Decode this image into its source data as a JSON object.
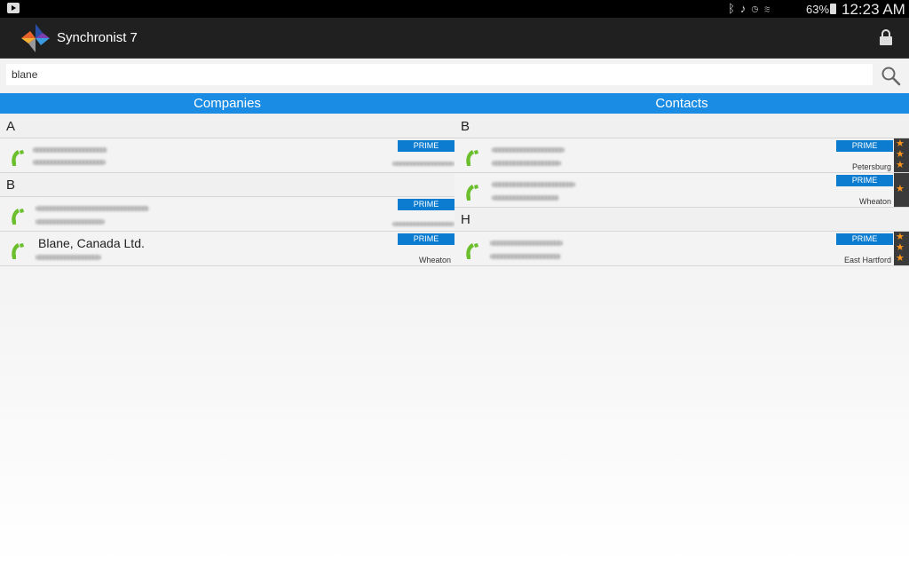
{
  "status_bar": {
    "battery_percent": "63%",
    "time": "12:23 AM"
  },
  "app": {
    "title": "Synchronist 7"
  },
  "search": {
    "value": "blane"
  },
  "columns": {
    "companies_label": "Companies",
    "contacts_label": "Contacts"
  },
  "companies": {
    "section_a": "A",
    "section_b": "B",
    "row1": {
      "badge": "PRIME"
    },
    "row2": {
      "badge": "PRIME"
    },
    "row3": {
      "name": "Blane, Canada Ltd.",
      "badge": "PRIME",
      "city": "Wheaton"
    }
  },
  "contacts": {
    "section_b": "B",
    "section_h": "H",
    "row1": {
      "badge": "PRIME",
      "city": "Petersburg",
      "stars": 3
    },
    "row2": {
      "badge": "PRIME",
      "city": "Wheaton",
      "stars": 1
    },
    "row3": {
      "badge": "PRIME",
      "city": "East Hartford",
      "stars": 3
    }
  },
  "colors": {
    "accent": "#1b8ce3",
    "badge": "#0b7cd0",
    "phone": "#6cbf2c",
    "star": "#f7941d"
  },
  "icons": [
    "notification-icon",
    "bluetooth-icon",
    "mute-icon",
    "alarm-icon",
    "wifi-icon",
    "battery-icon",
    "app-logo-icon",
    "lock-icon",
    "search-icon",
    "phone-icon",
    "star-icon"
  ]
}
